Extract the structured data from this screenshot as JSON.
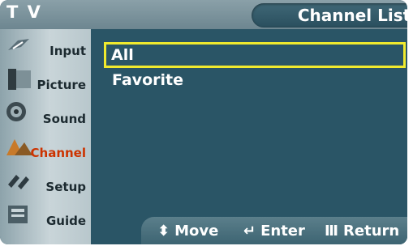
{
  "header": {
    "menu_title": "T V",
    "screen_title": "Channel List"
  },
  "sidebar": {
    "items": [
      {
        "label": "Input",
        "icon": "input-icon"
      },
      {
        "label": "Picture",
        "icon": "picture-icon"
      },
      {
        "label": "Sound",
        "icon": "sound-icon"
      },
      {
        "label": "Channel",
        "icon": "channel-icon",
        "active": true
      },
      {
        "label": "Setup",
        "icon": "setup-icon"
      },
      {
        "label": "Guide",
        "icon": "guide-icon"
      }
    ]
  },
  "options": [
    {
      "label": "All",
      "selected": true
    },
    {
      "label": "Favorite",
      "selected": false
    }
  ],
  "footer": {
    "move_label": "Move",
    "enter_label": "Enter",
    "return_label": "Return"
  },
  "colors": {
    "highlight": "#f0ea2e",
    "active_label": "#cc3300"
  }
}
